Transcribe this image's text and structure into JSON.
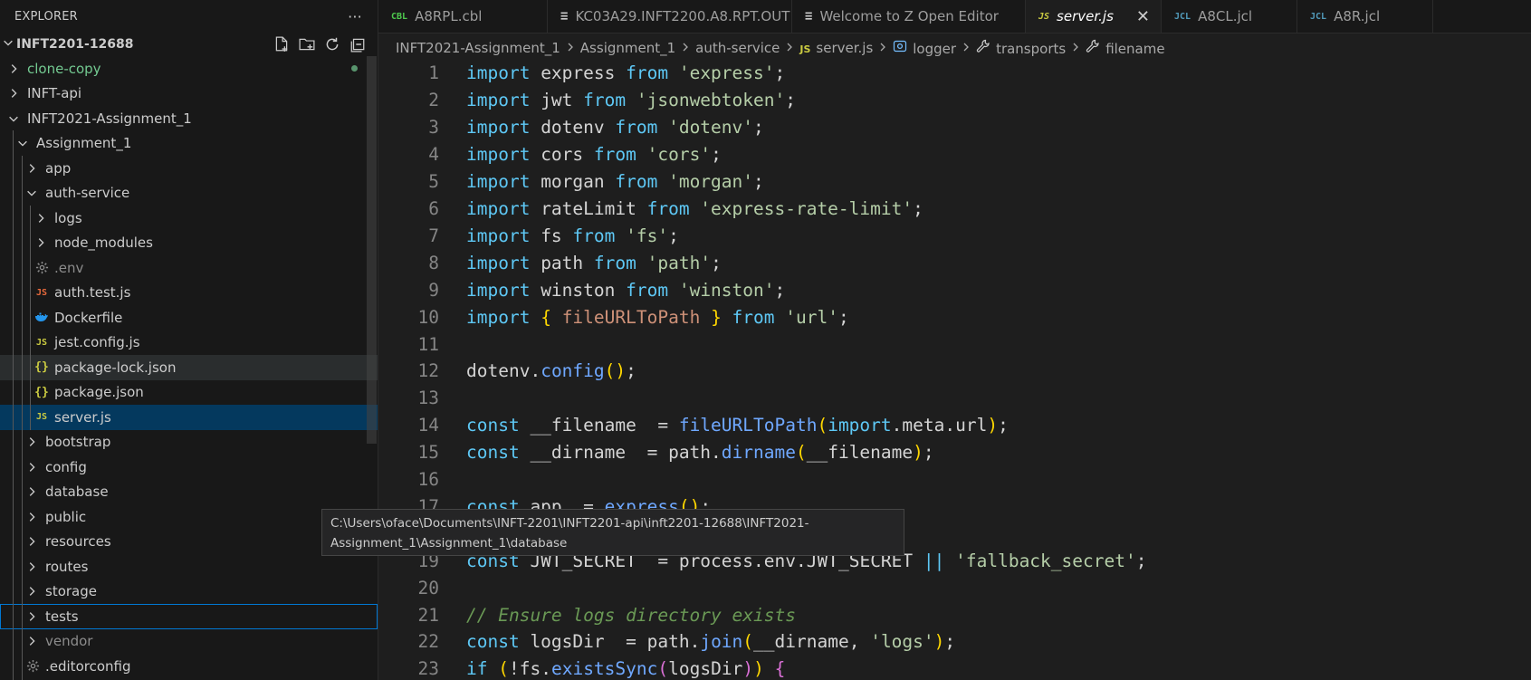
{
  "sidebar": {
    "title": "EXPLORER",
    "more": "···",
    "workspace": "INFT2201-12688",
    "items": [
      {
        "label": "clone-copy",
        "type": "folder",
        "expanded": false,
        "depth": 0,
        "color": "#73c991",
        "modified": true
      },
      {
        "label": "INFT-api",
        "type": "folder",
        "expanded": false,
        "depth": 0
      },
      {
        "label": "INFT2021-Assignment_1",
        "type": "folder",
        "expanded": true,
        "depth": 0
      },
      {
        "label": "Assignment_1",
        "type": "folder",
        "expanded": true,
        "depth": 1
      },
      {
        "label": "app",
        "type": "folder",
        "expanded": false,
        "depth": 2
      },
      {
        "label": "auth-service",
        "type": "folder",
        "expanded": true,
        "depth": 2
      },
      {
        "label": "logs",
        "type": "folder",
        "expanded": false,
        "depth": 3
      },
      {
        "label": "node_modules",
        "type": "folder",
        "expanded": false,
        "depth": 3
      },
      {
        "label": ".env",
        "type": "file",
        "icon": "gear",
        "depth": 3,
        "color": "#8c8c8c"
      },
      {
        "label": "auth.test.js",
        "type": "file",
        "icon": "JS",
        "depth": 3,
        "iconColor": "#e8693c"
      },
      {
        "label": "Dockerfile",
        "type": "file",
        "icon": "docker",
        "depth": 3
      },
      {
        "label": "jest.config.js",
        "type": "file",
        "icon": "JS",
        "depth": 3,
        "iconColor": "#cbcb41"
      },
      {
        "label": "package-lock.json",
        "type": "file",
        "icon": "{}",
        "depth": 3,
        "iconColor": "#cbcb41",
        "state": "hovered"
      },
      {
        "label": "package.json",
        "type": "file",
        "icon": "{}",
        "depth": 3,
        "iconColor": "#cbcb41"
      },
      {
        "label": "server.js",
        "type": "file",
        "icon": "JS",
        "depth": 3,
        "iconColor": "#cbcb41",
        "state": "selected"
      },
      {
        "label": "bootstrap",
        "type": "folder",
        "expanded": false,
        "depth": 2
      },
      {
        "label": "config",
        "type": "folder",
        "expanded": false,
        "depth": 2
      },
      {
        "label": "database",
        "type": "folder",
        "expanded": false,
        "depth": 2
      },
      {
        "label": "public",
        "type": "folder",
        "expanded": false,
        "depth": 2
      },
      {
        "label": "resources",
        "type": "folder",
        "expanded": false,
        "depth": 2
      },
      {
        "label": "routes",
        "type": "folder",
        "expanded": false,
        "depth": 2
      },
      {
        "label": "storage",
        "type": "folder",
        "expanded": false,
        "depth": 2
      },
      {
        "label": "tests",
        "type": "folder",
        "expanded": false,
        "depth": 2,
        "state": "focused"
      },
      {
        "label": "vendor",
        "type": "folder",
        "expanded": false,
        "depth": 2,
        "color": "#8c8c8c"
      },
      {
        "label": ".editorconfig",
        "type": "file",
        "icon": "gear",
        "depth": 2
      }
    ]
  },
  "tabs": [
    {
      "label": "A8RPL.cbl",
      "icon": "CBL",
      "iconColor": "#4ec94e",
      "width": 187
    },
    {
      "label": "KC03A29.INFT2200.A8.RPT.OUT",
      "icon": "≡",
      "iconColor": "#cccccc",
      "width": 270
    },
    {
      "label": "Welcome to Z Open Editor",
      "icon": "≡",
      "iconColor": "#cccccc",
      "width": 258
    },
    {
      "label": "server.js",
      "icon": "JS",
      "iconColor": "#cbcb41",
      "active": true,
      "close": "✕",
      "width": 150
    },
    {
      "label": "A8CL.jcl",
      "icon": "JCL",
      "iconColor": "#519aba",
      "width": 150
    },
    {
      "label": "A8R.jcl",
      "icon": "JCL",
      "iconColor": "#519aba",
      "width": 150
    }
  ],
  "breadcrumbs": [
    {
      "label": "INFT2021-Assignment_1"
    },
    {
      "label": "Assignment_1"
    },
    {
      "label": "auth-service"
    },
    {
      "label": "server.js",
      "icon": "JS"
    },
    {
      "label": "logger",
      "icon": "⦿"
    },
    {
      "label": "transports",
      "icon": "🔧"
    },
    {
      "label": "filename",
      "icon": "🔧"
    }
  ],
  "code": [
    {
      "n": "1",
      "t": [
        [
          "kw",
          "import"
        ],
        [
          "var",
          " express "
        ],
        [
          "kw",
          "from"
        ],
        [
          "str",
          " 'express'"
        ],
        [
          "",
          "; "
        ]
      ]
    },
    {
      "n": "2",
      "t": [
        [
          "kw",
          "import"
        ],
        [
          "var",
          " jwt "
        ],
        [
          "kw",
          "from"
        ],
        [
          "str",
          " 'jsonwebtoken'"
        ],
        [
          "",
          ";"
        ]
      ]
    },
    {
      "n": "3",
      "t": [
        [
          "kw",
          "import"
        ],
        [
          "var",
          " dotenv "
        ],
        [
          "kw",
          "from"
        ],
        [
          "str",
          " 'dotenv'"
        ],
        [
          "",
          ";"
        ]
      ]
    },
    {
      "n": "4",
      "t": [
        [
          "kw",
          "import"
        ],
        [
          "var",
          " cors "
        ],
        [
          "kw",
          "from"
        ],
        [
          "str",
          " 'cors'"
        ],
        [
          "",
          ";"
        ]
      ]
    },
    {
      "n": "5",
      "t": [
        [
          "kw",
          "import"
        ],
        [
          "var",
          " morgan "
        ],
        [
          "kw",
          "from"
        ],
        [
          "str",
          " 'morgan'"
        ],
        [
          "",
          ";"
        ]
      ]
    },
    {
      "n": "6",
      "t": [
        [
          "kw",
          "import"
        ],
        [
          "var",
          " rateLimit "
        ],
        [
          "kw",
          "from"
        ],
        [
          "str",
          " 'express-rate-limit'"
        ],
        [
          "",
          ";"
        ]
      ]
    },
    {
      "n": "7",
      "t": [
        [
          "kw",
          "import"
        ],
        [
          "var",
          " fs "
        ],
        [
          "kw",
          "from"
        ],
        [
          "str",
          " 'fs'"
        ],
        [
          "",
          ";"
        ]
      ]
    },
    {
      "n": "8",
      "t": [
        [
          "kw",
          "import"
        ],
        [
          "var",
          " path "
        ],
        [
          "kw",
          "from"
        ],
        [
          "str",
          " 'path'"
        ],
        [
          "",
          ";"
        ]
      ]
    },
    {
      "n": "9",
      "t": [
        [
          "kw",
          "import"
        ],
        [
          "var",
          " winston "
        ],
        [
          "kw",
          "from"
        ],
        [
          "str",
          " 'winston'"
        ],
        [
          "",
          ";"
        ]
      ]
    },
    {
      "n": "10",
      "t": [
        [
          "kw",
          "import"
        ],
        [
          "",
          " "
        ],
        [
          "br",
          "{"
        ],
        [
          "var2",
          " fileURLToPath "
        ],
        [
          "br",
          "}"
        ],
        [
          "kw",
          " from"
        ],
        [
          "str",
          " 'url'"
        ],
        [
          "",
          ";"
        ]
      ]
    },
    {
      "n": "11",
      "t": []
    },
    {
      "n": "12",
      "t": [
        [
          "var",
          "dotenv"
        ],
        [
          "",
          "."
        ],
        [
          "fn",
          "config"
        ],
        [
          "br",
          "()"
        ],
        [
          "",
          ";"
        ]
      ]
    },
    {
      "n": "13",
      "t": []
    },
    {
      "n": "14",
      "t": [
        [
          "kw",
          "const"
        ],
        [
          "obj",
          " __filename "
        ],
        [
          "",
          " = "
        ],
        [
          "fn",
          "fileURLToPath"
        ],
        [
          "br",
          "("
        ],
        [
          "kw",
          "import"
        ],
        [
          "",
          "."
        ],
        [
          "var",
          "meta"
        ],
        [
          "",
          "."
        ],
        [
          "var",
          "url"
        ],
        [
          "br",
          ")"
        ],
        [
          "",
          ";"
        ]
      ]
    },
    {
      "n": "15",
      "t": [
        [
          "kw",
          "const"
        ],
        [
          "obj",
          " __dirname "
        ],
        [
          "",
          " = "
        ],
        [
          "var",
          "path"
        ],
        [
          "",
          "."
        ],
        [
          "fn",
          "dirname"
        ],
        [
          "br",
          "("
        ],
        [
          "var",
          "__filename"
        ],
        [
          "br",
          ")"
        ],
        [
          "",
          ";"
        ]
      ]
    },
    {
      "n": "16",
      "t": []
    },
    {
      "n": "17",
      "t": [
        [
          "kw",
          "const"
        ],
        [
          "obj",
          " app "
        ],
        [
          "",
          " = "
        ],
        [
          "fn",
          "express"
        ],
        [
          "br",
          "()"
        ],
        [
          "",
          ";"
        ]
      ]
    },
    {
      "n": "18",
      "t": []
    },
    {
      "n": "19",
      "t": [
        [
          "kw",
          "const"
        ],
        [
          "obj",
          " JWT_SECRET "
        ],
        [
          "",
          " = "
        ],
        [
          "var",
          "process"
        ],
        [
          "",
          "."
        ],
        [
          "var",
          "env"
        ],
        [
          "",
          "."
        ],
        [
          "obj",
          "JWT_SECRET"
        ],
        [
          "kw",
          " ||"
        ],
        [
          "str",
          " 'fallback_secret'"
        ],
        [
          "",
          ";"
        ]
      ]
    },
    {
      "n": "20",
      "t": []
    },
    {
      "n": "21",
      "t": [
        [
          "cm",
          "// Ensure logs directory exists"
        ]
      ]
    },
    {
      "n": "22",
      "t": [
        [
          "kw",
          "const"
        ],
        [
          "obj",
          " logsDir "
        ],
        [
          "",
          " = "
        ],
        [
          "var",
          "path"
        ],
        [
          "",
          "."
        ],
        [
          "fn",
          "join"
        ],
        [
          "br",
          "("
        ],
        [
          "var",
          "__dirname"
        ],
        [
          "",
          ", "
        ],
        [
          "str",
          "'logs'"
        ],
        [
          "br",
          ")"
        ],
        [
          "",
          ";"
        ]
      ]
    },
    {
      "n": "23",
      "t": [
        [
          "kw",
          "if"
        ],
        [
          "",
          " "
        ],
        [
          "br",
          "("
        ],
        [
          "",
          "!"
        ],
        [
          "var",
          "fs"
        ],
        [
          "",
          "."
        ],
        [
          "fn",
          "existsSync"
        ],
        [
          "br2",
          "("
        ],
        [
          "var",
          "logsDir"
        ],
        [
          "br2",
          ")"
        ],
        [
          "br",
          ")"
        ],
        [
          "",
          " "
        ],
        [
          "br2",
          "{"
        ]
      ]
    }
  ],
  "tooltip": {
    "line1": "C:\\Users\\oface\\Documents\\INFT-2201\\INFT2201-api\\inft2201-12688\\INFT2021-",
    "line2": "Assignment_1\\Assignment_1\\database"
  }
}
